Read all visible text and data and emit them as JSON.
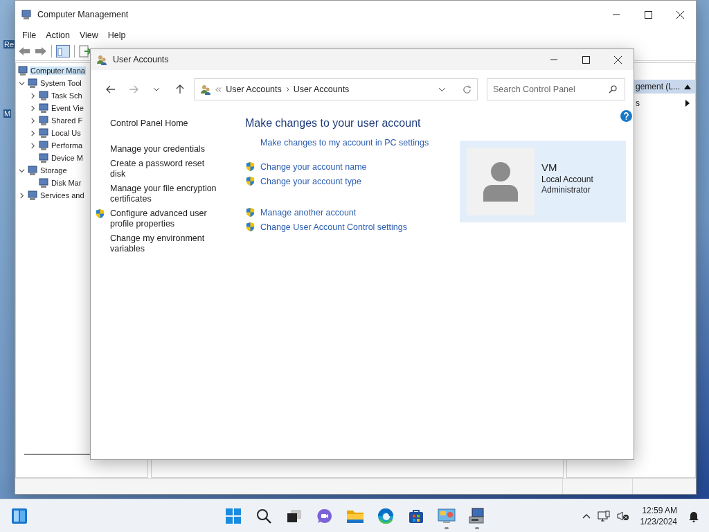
{
  "desktop": {
    "icon_labels": [
      "Re",
      "M"
    ]
  },
  "computer_management": {
    "title": "Computer Management",
    "menu": [
      "File",
      "Action",
      "View",
      "Help"
    ],
    "tree": [
      {
        "label": "Computer Mana",
        "selected": true,
        "children": [
          {
            "label": "System Tool",
            "selected": false,
            "expanded": true,
            "children": [
              {
                "label": "Task Sch",
                "selected": false,
                "expanded": false
              },
              {
                "label": "Event Vie",
                "selected": false,
                "expanded": false
              },
              {
                "label": "Shared F",
                "selected": false,
                "expanded": false
              },
              {
                "label": "Local Us",
                "selected": false,
                "expanded": false
              },
              {
                "label": "Performa",
                "selected": false,
                "expanded": false
              },
              {
                "label": "Device M",
                "selected": false
              }
            ]
          },
          {
            "label": "Storage",
            "selected": false,
            "expanded": true,
            "children": [
              {
                "label": "Disk Mar",
                "selected": false
              }
            ]
          },
          {
            "label": "Services and",
            "selected": false,
            "expanded": false
          }
        ]
      }
    ],
    "actions": {
      "header": "gement (L...",
      "items": [
        "s"
      ]
    }
  },
  "user_accounts": {
    "title": "User Accounts",
    "breadcrumb": [
      "User Accounts",
      "User Accounts"
    ],
    "search": {
      "placeholder": "Search Control Panel"
    },
    "sidebar": {
      "home": "Control Panel Home",
      "links": [
        {
          "label": "Manage your credentials",
          "shield": false
        },
        {
          "label": "Create a password reset disk",
          "shield": false
        },
        {
          "label": "Manage your file encryption certificates",
          "shield": false
        },
        {
          "label": "Configure advanced user profile properties",
          "shield": true
        },
        {
          "label": "Change my environment variables",
          "shield": false
        }
      ]
    },
    "heading": "Make changes to your user account",
    "task_groups": [
      [
        {
          "label": "Make changes to my account in PC settings",
          "shield": false
        }
      ],
      [
        {
          "label": "Change your account name",
          "shield": true
        },
        {
          "label": "Change your account type",
          "shield": true
        }
      ],
      [
        {
          "label": "Manage another account",
          "shield": true
        },
        {
          "label": "Change User Account Control settings",
          "shield": true
        }
      ]
    ],
    "account": {
      "name": "VM",
      "lines": [
        "Local Account",
        "Administrator"
      ]
    }
  },
  "taskbar": {
    "apps": [
      {
        "kind": "start",
        "running": false
      },
      {
        "kind": "search",
        "running": false
      },
      {
        "kind": "taskview",
        "running": false
      },
      {
        "kind": "chat",
        "running": false
      },
      {
        "kind": "folder",
        "running": false
      },
      {
        "kind": "browser",
        "running": false
      },
      {
        "kind": "store",
        "running": false
      },
      {
        "kind": "controlpanel",
        "running": true
      },
      {
        "kind": "management",
        "running": true
      }
    ],
    "time": "12:59 AM",
    "date": "1/23/2024"
  }
}
